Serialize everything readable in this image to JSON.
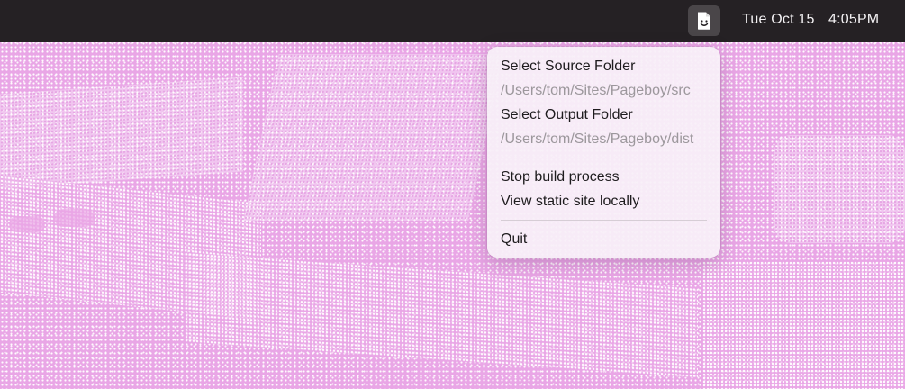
{
  "menubar": {
    "app_icon": "document-smiley-icon",
    "date": "Tue Oct 15",
    "time": "4:05PM"
  },
  "menu": {
    "items": [
      {
        "label": "Select Source Folder",
        "enabled": true
      },
      {
        "label": "/Users/tom/Sites/Pageboy/src",
        "enabled": false
      },
      {
        "label": "Select Output Folder",
        "enabled": true
      },
      {
        "label": "/Users/tom/Sites/Pageboy/dist",
        "enabled": false
      },
      {
        "label": "Stop build process",
        "enabled": true
      },
      {
        "label": "View static site locally",
        "enabled": true
      },
      {
        "label": "Quit",
        "enabled": true
      }
    ]
  },
  "colors": {
    "menubar_bg": "#252124",
    "wallpaper_pink": "#e9a6e6",
    "menu_bg": "#f8f0f7",
    "disabled_text": "#9c979c"
  }
}
